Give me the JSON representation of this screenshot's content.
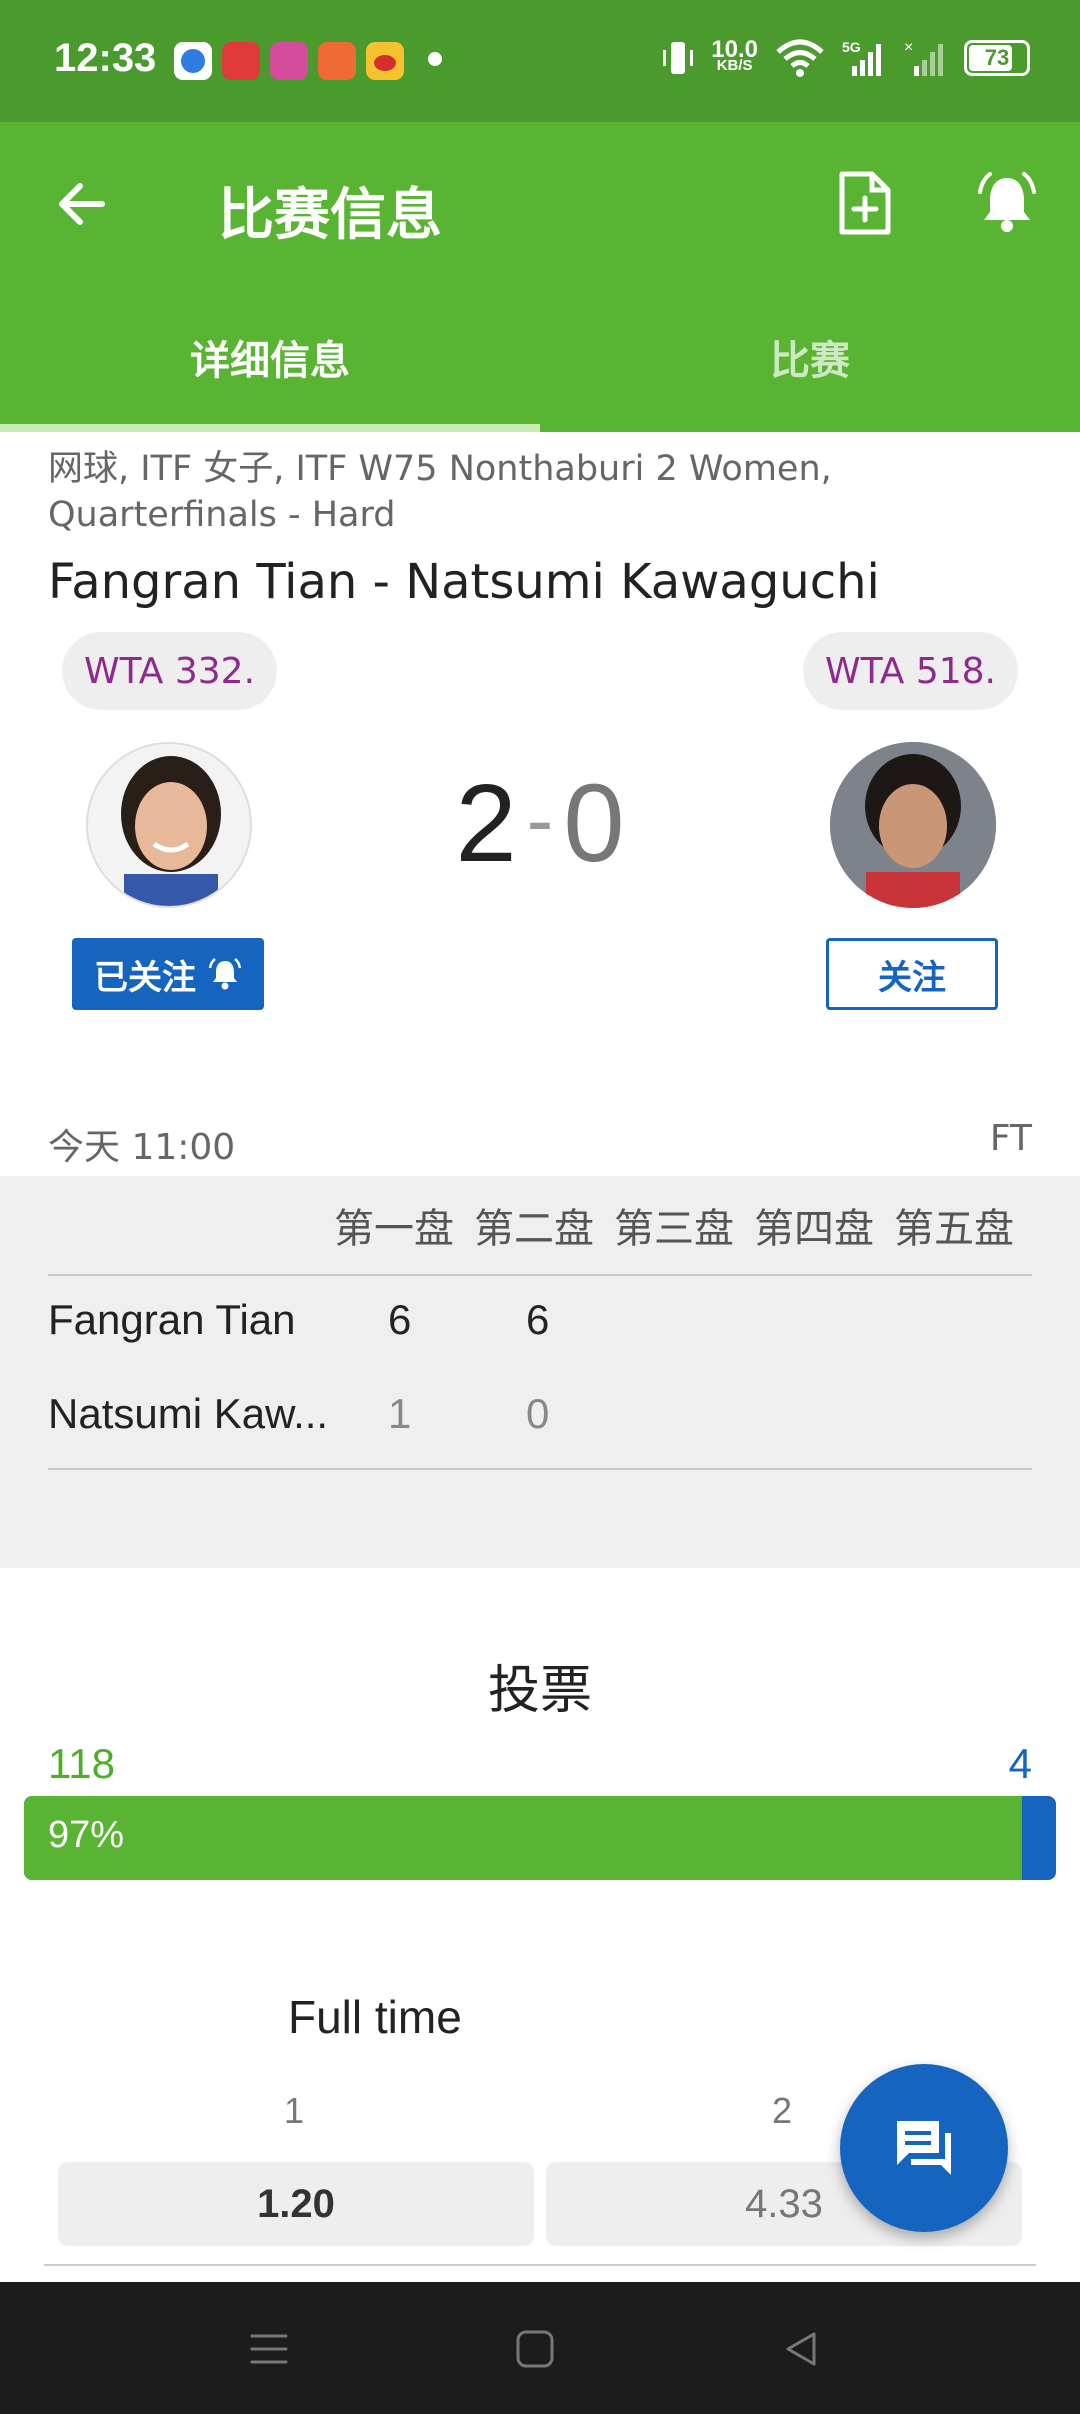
{
  "status_bar": {
    "time": "12:33",
    "net_speed_value": "10.0",
    "net_speed_unit": "KB/S",
    "network": "5G",
    "battery": "73"
  },
  "app_bar": {
    "title": "比赛信息",
    "icons": [
      "back-arrow-icon",
      "add-document-icon",
      "bell-icon"
    ]
  },
  "tabs": [
    {
      "label": "详细信息",
      "active": true
    },
    {
      "label": "比赛",
      "active": false
    }
  ],
  "match": {
    "breadcrumb": "网球, ITF 女子, ITF W75 Nonthaburi 2 Women, Quarterfinals - Hard",
    "title": "Fangran Tian - Natsumi Kawaguchi",
    "home_rank": "WTA 332.",
    "away_rank": "WTA 518.",
    "score_home": "2",
    "score_sep": "-",
    "score_away": "0",
    "home_follow_label": "已关注",
    "away_follow_label": "关注",
    "time": "今天 11:00",
    "status": "FT"
  },
  "sets": {
    "headers": [
      "第一盘",
      "第二盘",
      "第三盘",
      "第四盘",
      "第五盘"
    ],
    "rows": [
      {
        "player": "Fangran Tian",
        "scores": [
          "6",
          "6"
        ]
      },
      {
        "player": "Natsumi Kaw...",
        "scores": [
          "1",
          "0"
        ]
      }
    ]
  },
  "vote": {
    "title": "投票",
    "home_votes": "118",
    "away_votes": "4",
    "home_percent_label": "97%",
    "home_fraction": 0.967,
    "colors": {
      "home": "#5ab433",
      "away": "#1565c0"
    }
  },
  "odds": {
    "title": "Full time",
    "labels": [
      "1",
      "2"
    ],
    "values": [
      "1.20",
      "4.33"
    ]
  },
  "colors": {
    "status_bar": "#4a9a2e",
    "app_bar": "#5ab433",
    "accent_blue": "#1565c0",
    "rank_text": "#8e2a8e"
  }
}
